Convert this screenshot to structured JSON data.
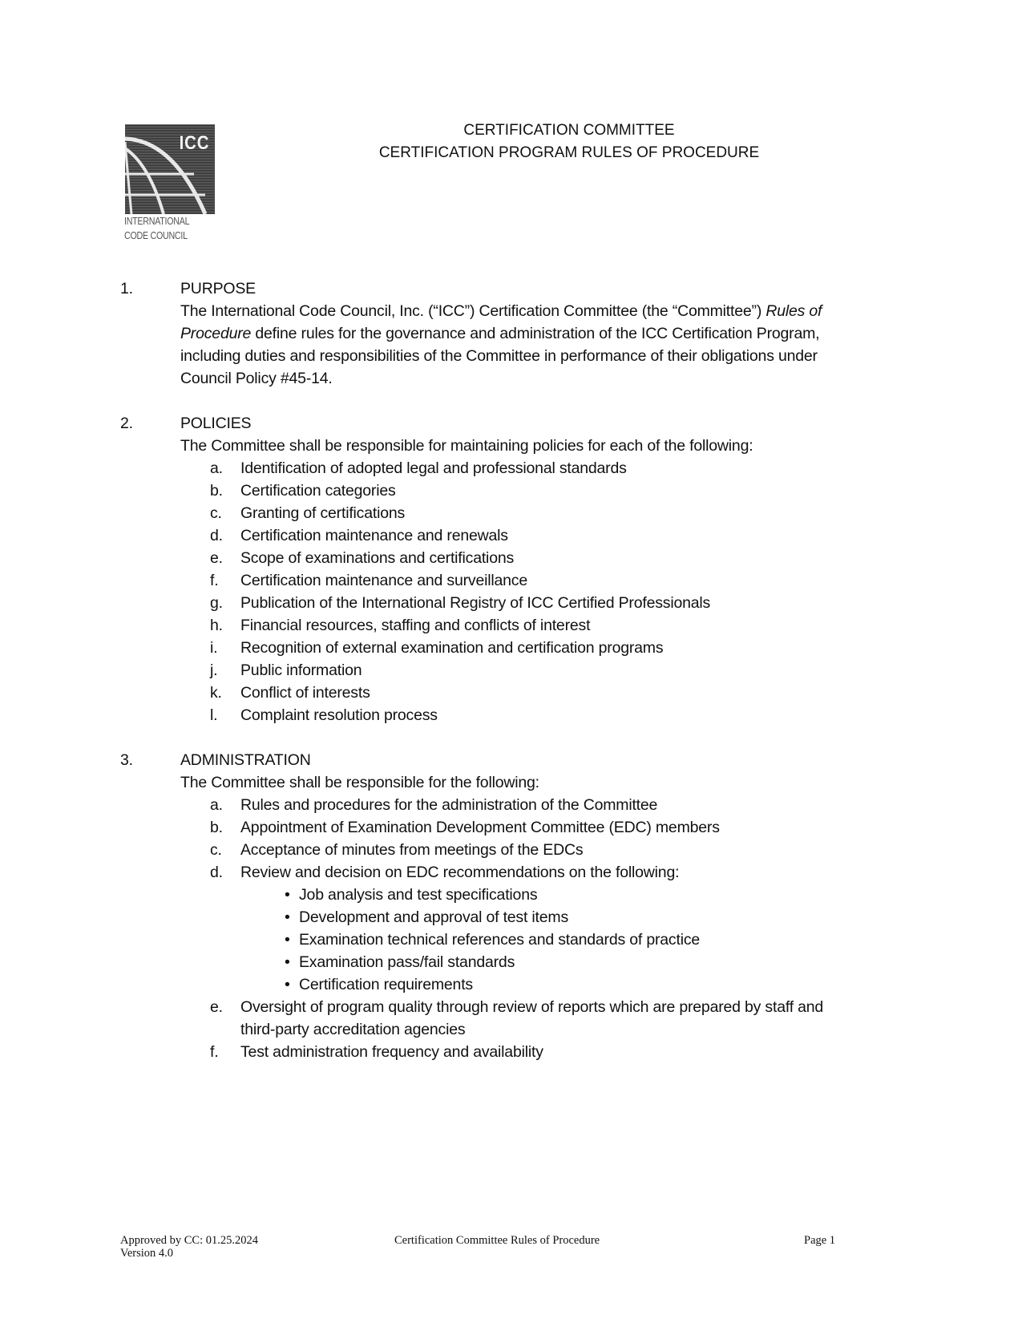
{
  "header": {
    "logo": {
      "mark": "ICC",
      "line1": "INTERNATIONAL",
      "line2": "CODE COUNCIL",
      "icon": "icc-globe-logo-icon"
    },
    "title_line1": "CERTIFICATION COMMITTEE",
    "title_line2": "CERTIFICATION PROGRAM RULES OF PROCEDURE"
  },
  "sections": [
    {
      "number": "1.",
      "heading": "PURPOSE",
      "body_lines": [
        {
          "pre": "The International Code Council, Inc. (“ICC”) Certification Committee (the “Committee”) ",
          "italic": "Rules of",
          "post": ""
        },
        {
          "pre": "",
          "italic": "Procedure",
          "post": " define rules for the governance and administration of the ICC Certification Program,"
        },
        {
          "pre": "including duties and responsibilities of the Committee in performance of their obligations under",
          "italic": "",
          "post": ""
        },
        {
          "pre": "Council Policy #45-14.",
          "italic": "",
          "post": ""
        }
      ]
    },
    {
      "number": "2.",
      "heading": "POLICIES",
      "intro": "The Committee shall be responsible for maintaining policies for each of the following:",
      "items": [
        {
          "letter": "a.",
          "text": "Identification of adopted legal and professional standards"
        },
        {
          "letter": "b.",
          "text": "Certification categories"
        },
        {
          "letter": "c.",
          "text": "Granting of certifications"
        },
        {
          "letter": "d.",
          "text": "Certification maintenance and renewals"
        },
        {
          "letter": "e.",
          "text": "Scope of examinations and certifications"
        },
        {
          "letter": "f.",
          "text": "Certification maintenance and surveillance"
        },
        {
          "letter": "g.",
          "text": "Publication of the International Registry of ICC Certified Professionals"
        },
        {
          "letter": "h.",
          "text": "Financial resources, staffing and conflicts of interest"
        },
        {
          "letter": "i.",
          "text": "Recognition of external examination and certification programs"
        },
        {
          "letter": "j.",
          "text": "Public information"
        },
        {
          "letter": "k.",
          "text": "Conflict of interests"
        },
        {
          "letter": "l.",
          "text": "Complaint resolution process"
        }
      ]
    },
    {
      "number": "3.",
      "heading": "ADMINISTRATION",
      "intro": "The Committee shall be responsible for the following:",
      "items": [
        {
          "letter": "a.",
          "text": "Rules and procedures for the administration of the Committee"
        },
        {
          "letter": "b.",
          "text": "Appointment of Examination Development Committee (EDC) members"
        },
        {
          "letter": "c.",
          "text": "Acceptance of minutes from meetings of the EDCs"
        },
        {
          "letter": "d.",
          "text": "Review and decision on EDC recommendations on the following:"
        },
        {
          "letter": "e.",
          "text": "Oversight of program quality through review of reports which are prepared by staff and",
          "cont": "third-party accreditation agencies"
        },
        {
          "letter": "f.",
          "text": "Test administration frequency and availability"
        }
      ],
      "bullets": [
        "Job analysis and test specifications",
        "Development and approval of test items",
        "Examination technical references and standards of practice",
        "Examination pass/fail standards",
        "Certification requirements"
      ],
      "bullet_glyph": "•"
    }
  ],
  "footer": {
    "approved": "Approved by CC: 01.25.2024",
    "version": "Version 4.0",
    "center": "Certification Committee Rules of Procedure",
    "page": "Page 1"
  }
}
